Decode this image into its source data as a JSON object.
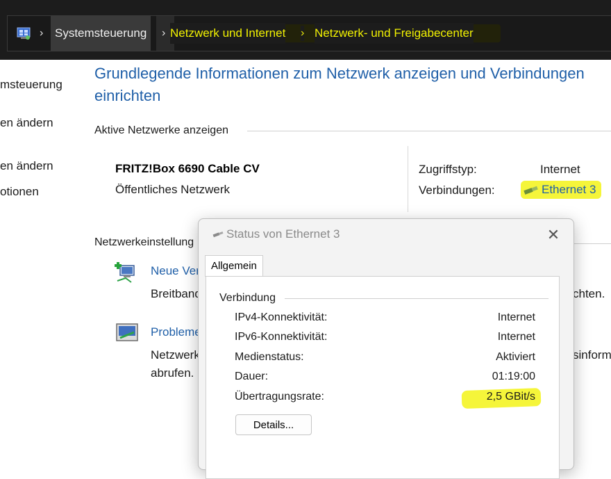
{
  "breadcrumb": {
    "root": "Systemsteuerung",
    "items": [
      "Netzwerk und Internet",
      "Netzwerk- und Freigabecenter"
    ],
    "separator": "›"
  },
  "sidebar": {
    "items": [
      {
        "label": "msteuerung"
      },
      {
        "label": "en ändern"
      },
      {
        "label": "en ändern"
      },
      {
        "label": "otionen"
      }
    ]
  },
  "main": {
    "heading_line1": "Grundlegende Informationen zum Netzwerk anzeigen und Verbindungen",
    "heading_line2": "einrichten",
    "active_networks_label": "Aktive Netzwerke anzeigen",
    "network": {
      "name": "FRITZ!Box 6690 Cable CV",
      "type": "Öffentliches Netzwerk",
      "access_type_label": "Zugriffstyp:",
      "access_type_value": "Internet",
      "connections_label": "Verbindungen:",
      "connections_value": "Ethernet 3"
    },
    "settings_label": "Netzwerkeinstellung",
    "tasks": [
      {
        "link": "Neue Ver",
        "line1": "Breitband",
        "line1_tail": "chten.",
        "line2": ""
      },
      {
        "link": "Probleme",
        "line1": "Netzwerk",
        "line1_tail": "sinform",
        "line2": "abrufen."
      }
    ]
  },
  "dialog": {
    "title": "Status von Ethernet 3",
    "close": "✕",
    "tab": "Allgemein",
    "group_label": "Verbindung",
    "rows": [
      {
        "label": "IPv4-Konnektivität:",
        "value": "Internet"
      },
      {
        "label": "IPv6-Konnektivität:",
        "value": "Internet"
      },
      {
        "label": "Medienstatus:",
        "value": "Aktiviert"
      },
      {
        "label": "Dauer:",
        "value": "01:19:00"
      },
      {
        "label": "Übertragungsrate:",
        "value": "2,5 GBit/s"
      }
    ],
    "details_button": "Details..."
  },
  "icons": {
    "address_bar": "control-panel-icon",
    "connection": "ethernet-icon",
    "task_new_connection": "new-connection-icon",
    "task_troubleshoot": "troubleshoot-icon"
  },
  "colors": {
    "highlight": "#f5f53a",
    "link": "#1f5fa8",
    "breadcrumb_highlight_text": "#f2f200"
  }
}
